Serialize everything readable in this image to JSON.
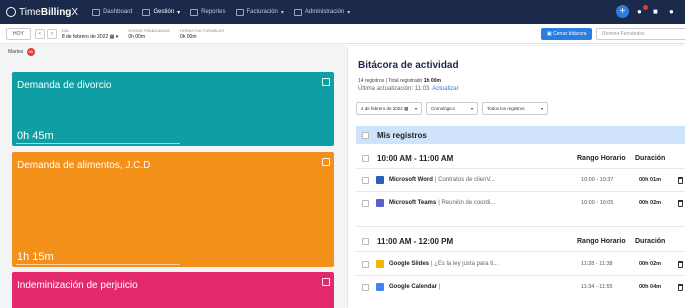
{
  "app": {
    "brand_prefix": "Time",
    "brand_bold": "Billing",
    "brand_suffix": "X"
  },
  "nav": {
    "items": [
      {
        "label": "Dashboard",
        "icon": "chart-icon"
      },
      {
        "label": "Gestión",
        "icon": "briefcase-icon"
      },
      {
        "label": "Reportes",
        "icon": "report-icon"
      },
      {
        "label": "Facturación",
        "icon": "invoice-icon"
      },
      {
        "label": "Administración",
        "icon": "admin-icon"
      }
    ]
  },
  "subbar": {
    "today_label": "HOY",
    "day_label": "DÍA",
    "date_value": "8 de febrero de 2022",
    "worked_label": "HORAS TRABAJADAS",
    "worked_value": "0h 00m",
    "billable_label": "HORAS FACTURABLES",
    "billable_value": "0h 00m",
    "close_log_label": "Cerrar bitácora",
    "user_value": "Romina Fernández"
  },
  "day_header": {
    "label": "Martes",
    "badge": "08"
  },
  "cards": [
    {
      "title": "Demanda de divorcio",
      "hours": "0h 45m",
      "color": "#0e9ea3"
    },
    {
      "title": "Demanda de alimentos, J.C.D",
      "hours": "1h 15m",
      "color": "#f39019"
    },
    {
      "title": "Indeminización de perjuicio",
      "hours": "",
      "color": "#e3286b"
    }
  ],
  "bitacora": {
    "title": "Bitácora de actividad",
    "count_text": "14 registros | Total registrado",
    "total": "1h 00m",
    "last_update_label": "Última actualización: 11:03",
    "update_link": "Actualizar",
    "filter_date": "4 de febrero de 2022",
    "filter_order": "Cronológico",
    "filter_records": "Todos los registros",
    "my_records": "Mis registros",
    "col_range": "Rango Horario",
    "col_duration": "Duración",
    "groups": [
      {
        "label": "10:00 AM - 11:00 AM",
        "rows": [
          {
            "app": "Microsoft Word",
            "desc": "| Contratos de clienV...",
            "range": "10:00 - 10:37",
            "dur": "00h 01m",
            "color": "#2b5fbd"
          },
          {
            "app": "Microsoft Teams",
            "desc": "| Reunión de coordi...",
            "range": "10:00 - 10:05",
            "dur": "00h 02m",
            "color": "#5a5fc7"
          }
        ]
      },
      {
        "label": "11:00 AM - 12:00 PM",
        "rows": [
          {
            "app": "Google Slides",
            "desc": "| ¿Es la ley justa para ti...",
            "range": "11:28 - 11:38",
            "dur": "00h 02m",
            "color": "#f4b400"
          },
          {
            "app": "Google Calendar",
            "desc": "|",
            "range": "11:34 - 11:55",
            "dur": "00h 04m",
            "color": "#4285f4"
          }
        ]
      }
    ]
  }
}
